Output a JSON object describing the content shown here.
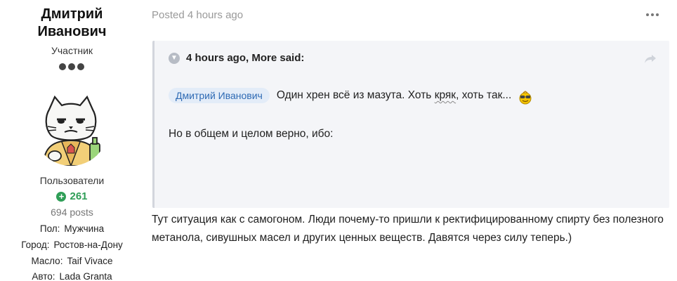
{
  "author": {
    "name_line1": "Дмитрий",
    "name_line2": "Иванович",
    "rank": "Участник",
    "group": "Пользователи",
    "reputation": "261",
    "posts": "694 posts",
    "fields": [
      {
        "key": "Пол:",
        "value": "Мужчина"
      },
      {
        "key": "Город:",
        "value": "Ростов-на-Дону"
      },
      {
        "key": "Масло:",
        "value": "Taif Vivace"
      },
      {
        "key": "Авто:",
        "value": "Lada Granta"
      }
    ]
  },
  "post": {
    "date": "Posted 4 hours ago",
    "quote": {
      "citation": "4 hours ago, More said:",
      "mention": "Дмитрий Иванович",
      "text_before": "Один хрен всё из мазута. Хоть ",
      "text_squiggle": "кряк",
      "text_after": ", хоть так...",
      "line2": "Но в общем и целом верно, ибо:"
    },
    "body": "Тут ситуация как с самогоном. Люди почему-то пришли к ректифицированному спирту без полезного метанола, сивушных масел и других ценных веществ. Давятся через силу теперь.)"
  },
  "icons": {
    "menu": "more-horizontal-icon",
    "chevron": "chevron-down-icon",
    "share": "share-arrow-icon",
    "reputation": "plus-circle-icon",
    "smiley": "smiley-emoji-icon"
  },
  "colors": {
    "reputation": "#2f9e57",
    "mention_bg": "#e3ecf8",
    "mention_text": "#2e6ab4",
    "quote_bg": "#f4f5f8"
  }
}
